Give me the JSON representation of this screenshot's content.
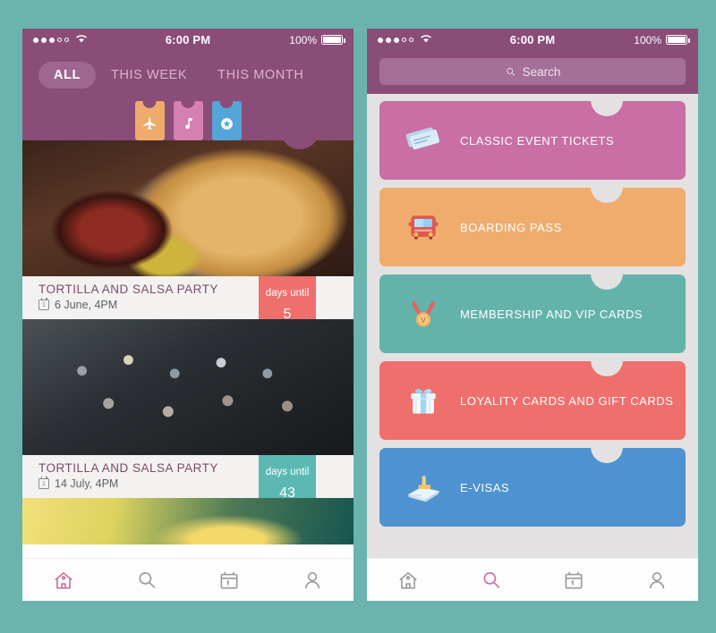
{
  "theme": {
    "background": "#6ab3ae",
    "header_purple": "#8a4d78",
    "accent_pink": "#c96fa5",
    "list_background": "#e3e1e1"
  },
  "status_bar": {
    "time": "6:00 PM",
    "battery_text": "100%",
    "signal_dots_filled": 3,
    "signal_dots_total": 5,
    "wifi_icon": "wifi-icon",
    "battery_icon": "battery-full-icon"
  },
  "left_phone": {
    "segments": [
      {
        "label": "ALL",
        "active": true
      },
      {
        "label": "THIS WEEK",
        "active": false
      },
      {
        "label": "THIS MONTH",
        "active": false
      }
    ],
    "category_tags": [
      {
        "icon": "airplane-icon",
        "color": "#efab6b"
      },
      {
        "icon": "music-note-icon",
        "color": "#d580b4"
      },
      {
        "icon": "star-badge-icon",
        "color": "#55a5d8"
      }
    ],
    "events": [
      {
        "title": "TORTILLA  AND SALSA PARTY",
        "date": "6 June, 4PM",
        "days_label": "days until",
        "days_value": "5",
        "badge_color": "#ef6f6c",
        "photo": "food-photo"
      },
      {
        "title": "TORTILLA  AND SALSA PARTY",
        "date": "14 July, 4PM",
        "days_label": "days until",
        "days_value": "43",
        "badge_color": "#5cb8b2",
        "photo": "mixer-photo"
      }
    ],
    "tabs": [
      {
        "icon": "home-icon",
        "active": true
      },
      {
        "icon": "search-icon",
        "active": false
      },
      {
        "icon": "calendar-icon",
        "active": false
      },
      {
        "icon": "profile-icon",
        "active": false
      }
    ]
  },
  "right_phone": {
    "search": {
      "placeholder": "Search",
      "value": "",
      "icon": "search-icon"
    },
    "categories": [
      {
        "label": "CLASSIC  EVENT TICKETS",
        "color": "#c96fa5",
        "icon": "tickets-icon"
      },
      {
        "label": "BOARDING PASS",
        "color": "#f0ac6d",
        "icon": "bus-icon"
      },
      {
        "label": "MEMBERSHIP AND VIP CARDS",
        "color": "#63b3ab",
        "icon": "medal-icon"
      },
      {
        "label": "LOYALITY CARDS AND GIFT CARDS",
        "color": "#ef6f6c",
        "icon": "gift-icon"
      },
      {
        "label": "E-VISAS",
        "color": "#4f92d1",
        "icon": "stamp-icon"
      }
    ],
    "tabs": [
      {
        "icon": "home-icon",
        "active": false
      },
      {
        "icon": "search-icon",
        "active": true
      },
      {
        "icon": "calendar-icon",
        "active": false
      },
      {
        "icon": "profile-icon",
        "active": false
      }
    ]
  }
}
